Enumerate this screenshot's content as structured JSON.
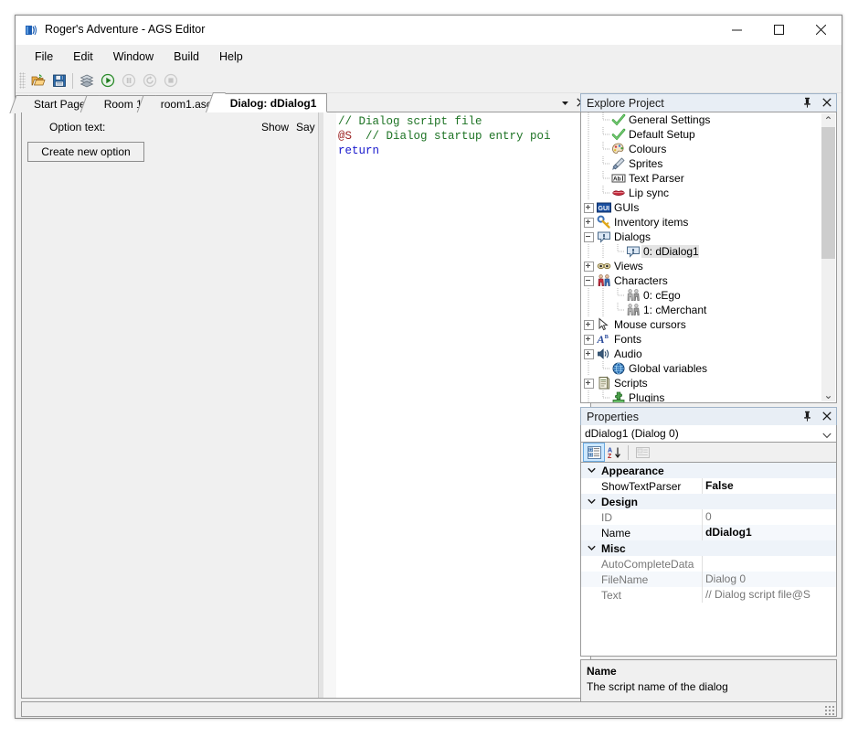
{
  "window": {
    "title": "Roger's Adventure - AGS Editor",
    "app_icon": "ags-logo-icon",
    "minimize_label": "Minimize",
    "maximize_label": "Maximize",
    "close_label": "Close"
  },
  "menubar": {
    "items": [
      {
        "label": "File"
      },
      {
        "label": "Edit"
      },
      {
        "label": "Window"
      },
      {
        "label": "Build"
      },
      {
        "label": "Help"
      }
    ]
  },
  "toolbar": {
    "buttons": [
      {
        "name": "open-project-icon",
        "title": "Open",
        "enabled": true
      },
      {
        "name": "save-icon",
        "title": "Save",
        "enabled": true
      },
      {
        "name": "build-icon",
        "title": "Build",
        "enabled": true
      },
      {
        "name": "run-icon",
        "title": "Run",
        "enabled": true
      },
      {
        "name": "pause-icon",
        "title": "Pause",
        "enabled": false
      },
      {
        "name": "restart-icon",
        "title": "Restart",
        "enabled": false
      },
      {
        "name": "stop-icon",
        "title": "Stop",
        "enabled": false
      }
    ]
  },
  "tabs": {
    "items": [
      {
        "label": "Start Page",
        "active": false
      },
      {
        "label": "Room 1",
        "active": false
      },
      {
        "label": "room1.asc",
        "active": false
      },
      {
        "label": "Dialog: dDialog1",
        "active": true
      }
    ],
    "dropdown_icon": "chevron-down-icon",
    "close_icon": "close-icon"
  },
  "dialog_editor": {
    "option_text_label": "Option text:",
    "show_column": "Show",
    "say_column": "Say",
    "create_option_button": "Create new option",
    "script": {
      "lines": [
        {
          "type": "comment",
          "text": "// Dialog script file"
        },
        {
          "type": "mixed",
          "at": "@S",
          "gap": "  ",
          "comment": "// Dialog startup entry poi"
        },
        {
          "type": "keyword",
          "text": "return"
        }
      ]
    }
  },
  "explorer": {
    "title": "Explore Project",
    "pin_icon": "pin-icon",
    "close_icon": "close-icon",
    "nodes": [
      {
        "label": "General Settings",
        "icon": "green-check-icon",
        "indent": 1,
        "toggle": "none"
      },
      {
        "label": "Default Setup",
        "icon": "green-check-icon",
        "indent": 1,
        "toggle": "none"
      },
      {
        "label": "Colours",
        "icon": "palette-icon",
        "indent": 1,
        "toggle": "none"
      },
      {
        "label": "Sprites",
        "icon": "brush-icon",
        "indent": 1,
        "toggle": "none"
      },
      {
        "label": "Text Parser",
        "icon": "text-parser-icon",
        "indent": 1,
        "toggle": "none"
      },
      {
        "label": "Lip sync",
        "icon": "lips-icon",
        "indent": 1,
        "toggle": "none"
      },
      {
        "label": "GUIs",
        "icon": "gui-icon",
        "indent": 0,
        "toggle": "plus"
      },
      {
        "label": "Inventory items",
        "icon": "key-icon",
        "indent": 0,
        "toggle": "plus"
      },
      {
        "label": "Dialogs",
        "icon": "speech-bubble-icon",
        "indent": 0,
        "toggle": "minus"
      },
      {
        "label": "0: dDialog1",
        "icon": "speech-bubble-icon",
        "indent": 2,
        "toggle": "none",
        "selected": true
      },
      {
        "label": "Views",
        "icon": "eyes-icon",
        "indent": 0,
        "toggle": "plus"
      },
      {
        "label": "Characters",
        "icon": "characters-icon",
        "indent": 0,
        "toggle": "minus"
      },
      {
        "label": "0: cEgo",
        "icon": "character-icon",
        "indent": 2,
        "toggle": "none"
      },
      {
        "label": "1: cMerchant",
        "icon": "character-icon",
        "indent": 2,
        "toggle": "none"
      },
      {
        "label": "Mouse cursors",
        "icon": "cursor-icon",
        "indent": 0,
        "toggle": "plus"
      },
      {
        "label": "Fonts",
        "icon": "font-icon",
        "indent": 0,
        "toggle": "plus"
      },
      {
        "label": "Audio",
        "icon": "speaker-icon",
        "indent": 0,
        "toggle": "plus"
      },
      {
        "label": "Global variables",
        "icon": "globe-icon",
        "indent": 1,
        "toggle": "none"
      },
      {
        "label": "Scripts",
        "icon": "script-icon",
        "indent": 0,
        "toggle": "plus"
      },
      {
        "label": "Plugins",
        "icon": "plugin-icon",
        "indent": 1,
        "toggle": "none"
      }
    ]
  },
  "properties": {
    "title": "Properties",
    "pin_icon": "pin-icon",
    "close_icon": "close-icon",
    "selected_object": "dDialog1 (Dialog 0)",
    "dropdown_icon": "chevron-down-icon",
    "toolbar": [
      {
        "name": "categorized-view-icon",
        "active": true
      },
      {
        "name": "alphabetical-sort-icon",
        "active": false
      },
      {
        "name": "property-pages-icon",
        "active": false,
        "enabled": false
      }
    ],
    "rows": [
      {
        "kind": "category",
        "name": "Appearance"
      },
      {
        "kind": "prop",
        "name": "ShowTextParser",
        "value": "False",
        "bold_value": true,
        "dim_name": false
      },
      {
        "kind": "category",
        "name": "Design"
      },
      {
        "kind": "prop",
        "name": "ID",
        "value": "0",
        "bold_value": false,
        "dim_name": true
      },
      {
        "kind": "prop",
        "name": "Name",
        "value": "dDialog1",
        "bold_value": true,
        "dim_name": false
      },
      {
        "kind": "category",
        "name": "Misc"
      },
      {
        "kind": "prop",
        "name": "AutoCompleteData",
        "value": "",
        "bold_value": false,
        "dim_name": true
      },
      {
        "kind": "prop",
        "name": "FileName",
        "value": "Dialog 0",
        "bold_value": false,
        "dim_name": true
      },
      {
        "kind": "prop",
        "name": "Text",
        "value": "// Dialog script file@S",
        "bold_value": false,
        "dim_name": true
      }
    ],
    "help_title": "Name",
    "help_text": "The script name of the dialog"
  },
  "scrollbars": {
    "left_arrow": "❮",
    "right_arrow": "❯",
    "up_arrow": "⌃",
    "down_arrow": "⌄"
  },
  "colors": {
    "accent": "#0078d7",
    "panel_header": "#e8eef5",
    "comment_green": "#1d7324",
    "keyword_blue": "#1818cd",
    "at_red": "#9a2020"
  }
}
